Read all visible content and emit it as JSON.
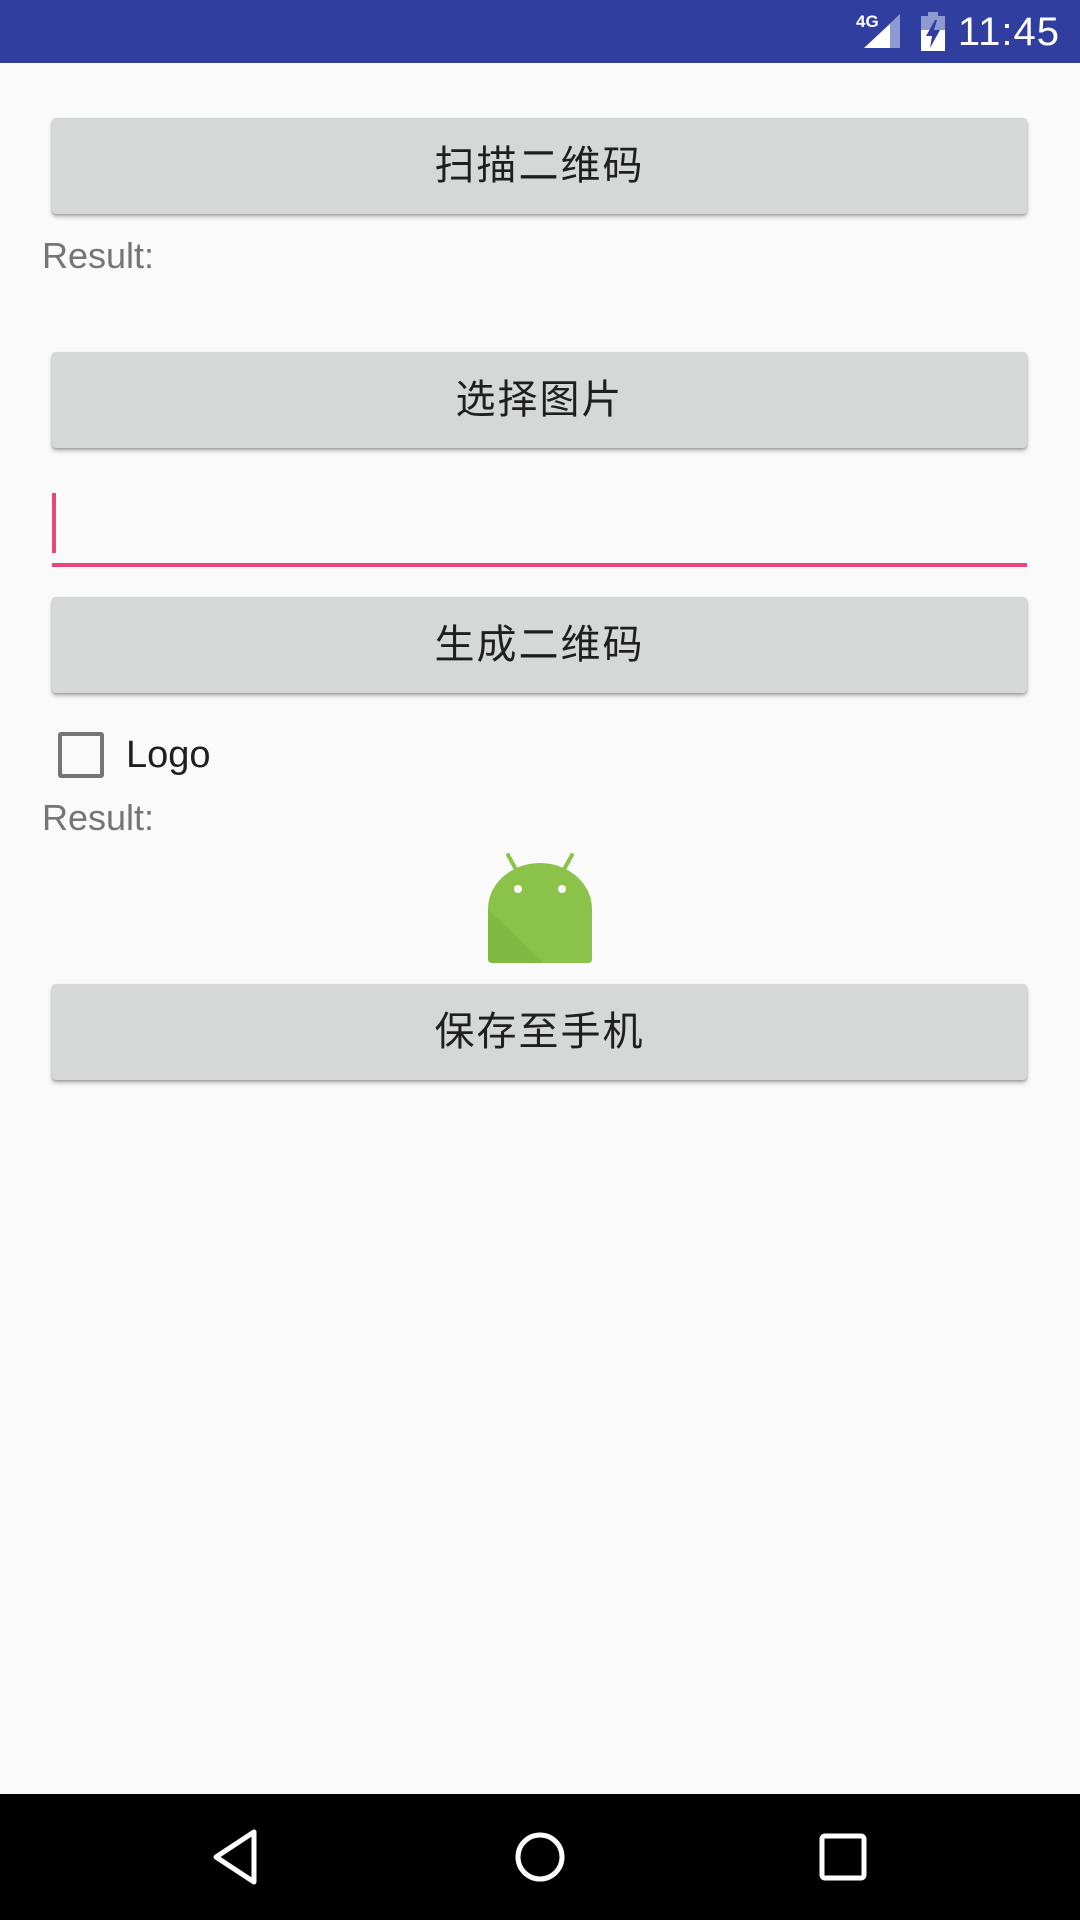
{
  "status_bar": {
    "network": "4G",
    "time": "11:45"
  },
  "buttons": {
    "scan": "扫描二维码",
    "choose_image": "选择图片",
    "generate": "生成二维码",
    "save": "保存至手机"
  },
  "scan_result_label": "Result:",
  "text_input": {
    "value": "",
    "placeholder": ""
  },
  "logo_checkbox": {
    "label": "Logo",
    "checked": false
  },
  "generate_result_label": "Result:",
  "colors": {
    "status_bar": "#303f9f",
    "accent": "#e9467f",
    "button_bg": "#d6d7d7",
    "android_green": "#8bc34a"
  },
  "icons": {
    "signal": "signal-icon",
    "battery": "battery-icon",
    "result_image": "android-icon",
    "back": "back-icon",
    "home": "home-icon",
    "recents": "recents-icon"
  }
}
